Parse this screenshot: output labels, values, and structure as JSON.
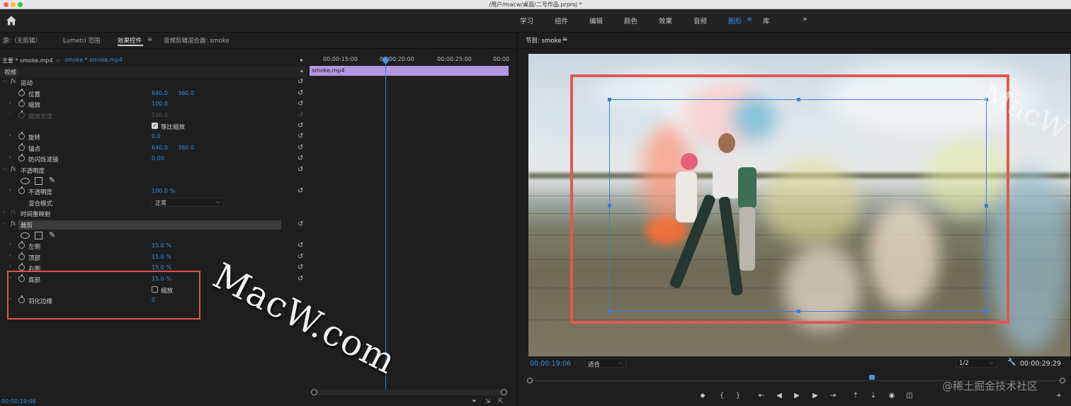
{
  "window": {
    "title": "/用户/macw/桌面/二号作品.prproj *"
  },
  "workspace_tabs": [
    {
      "label": "学习",
      "active": false
    },
    {
      "label": "组件",
      "active": false
    },
    {
      "label": "编辑",
      "active": false
    },
    {
      "label": "颜色",
      "active": false
    },
    {
      "label": "效果",
      "active": false
    },
    {
      "label": "音频",
      "active": false
    },
    {
      "label": "图形",
      "active": true
    },
    {
      "label": "库",
      "active": false
    }
  ],
  "workspace_more": "»",
  "left_panel": {
    "tabs": [
      "源:（无剪辑）",
      "Lumetri 范围",
      "效果控件",
      "音频剪辑混合器: smoke"
    ],
    "tab_menu_icon": "≡",
    "master_clip": "主要 * smoke.mp4",
    "sequence_clip": "smoke * smoke.mp4",
    "properties": {
      "video_header": "视频",
      "motion": "运动",
      "position": {
        "label": "位置",
        "x": "640.0",
        "y": "360.0"
      },
      "scale": {
        "label": "缩放",
        "value": "100.0"
      },
      "scale_width": {
        "label": "缩放宽度",
        "value": "100.0"
      },
      "uniform_scale": {
        "label": "等比缩放",
        "checked": true
      },
      "rotation": {
        "label": "旋转",
        "value": "0.0"
      },
      "anchor": {
        "label": "锚点",
        "x": "640.0",
        "y": "360.0"
      },
      "antiflicker": {
        "label": "防闪烁滤镜",
        "value": "0.00"
      },
      "opacity_section": "不透明度",
      "opacity": {
        "label": "不透明度",
        "value": "100.0 %"
      },
      "blend_mode": {
        "label": "混合模式",
        "value": "正常"
      },
      "time_remap": "时间重映射",
      "crop_section": "裁剪",
      "crop_left": {
        "label": "左侧",
        "value": "15.0 %"
      },
      "crop_top": {
        "label": "顶部",
        "value": "15.0 %"
      },
      "crop_right": {
        "label": "右侧",
        "value": "15.0 %"
      },
      "crop_bottom": {
        "label": "底部",
        "value": "15.0 %"
      },
      "zoom": {
        "label": "缩放",
        "checked": false
      },
      "feather": {
        "label": "羽化边缘",
        "value": "0"
      }
    },
    "timeline": {
      "ticks": [
        "00:00:15:00",
        "00:00:20:00",
        "00:00:25:00",
        "00:00"
      ],
      "clip_name": "smoke.mp4"
    },
    "current_time": "00:00:19:06"
  },
  "program_monitor": {
    "title": "节目: smoke",
    "menu_icon": "≡",
    "current_time": "00:00:19:06",
    "fit": "适合",
    "resolution": "1/2",
    "duration": "00:00:29:29"
  },
  "watermarks": {
    "main": "MacW.com",
    "corner": "MacW",
    "credit": "@稀土掘金技术社区"
  },
  "colors": {
    "accent": "#3a8dde",
    "clip": "#b197e0",
    "crop_outline": "#e0504a",
    "transform_box": "#3f7ce2"
  }
}
